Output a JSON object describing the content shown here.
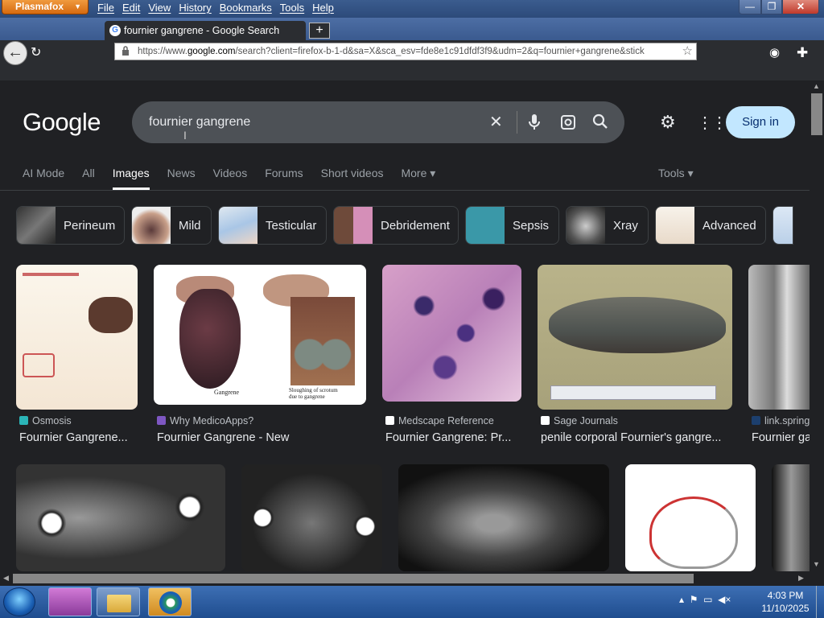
{
  "browser": {
    "app_name": "Plasmafox",
    "menu": [
      "File",
      "Edit",
      "View",
      "History",
      "Bookmarks",
      "Tools",
      "Help"
    ],
    "tab_title": "fournier gangrene - Google Search",
    "url_prefix": "https://www.",
    "url_host": "google.com",
    "url_rest": "/search?client=firefox-b-1-d&sa=X&sca_esv=fde8e1c91dfdf3f9&udm=2&q=fournier+gangrene&stick"
  },
  "google": {
    "logo": "Google",
    "query": "fournier gangrene",
    "sign_in": "Sign in",
    "tabs": [
      "AI Mode",
      "All",
      "Images",
      "News",
      "Videos",
      "Forums",
      "Short videos",
      "More ▾"
    ],
    "active_tab": "Images",
    "tools": "Tools ▾"
  },
  "chips": [
    "Perineum",
    "Mild",
    "Testicular",
    "Debridement",
    "Sepsis",
    "Xray",
    "Advanced"
  ],
  "results": [
    {
      "source": "Osmosis",
      "title": "Fournier Gangrene..."
    },
    {
      "source": "Why MedicoApps?",
      "title": "Fournier Gangrene - New"
    },
    {
      "source": "Medscape Reference",
      "title": "Fournier Gangrene: Pr..."
    },
    {
      "source": "Sage Journals",
      "title": "penile corporal Fournier's gangre..."
    },
    {
      "source": "link.spring",
      "title": "Fournier ga"
    }
  ],
  "image_captions": {
    "left": "Gangrene",
    "right": "Sloughing of scrotum due to gangrene"
  },
  "taskbar": {
    "time": "4:03 PM",
    "date": "11/10/2025"
  },
  "colors": {
    "bg": "#202124",
    "search_bg": "#4d5156",
    "signin_bg": "#c2e7ff",
    "taskbar": "#2a5da0"
  }
}
